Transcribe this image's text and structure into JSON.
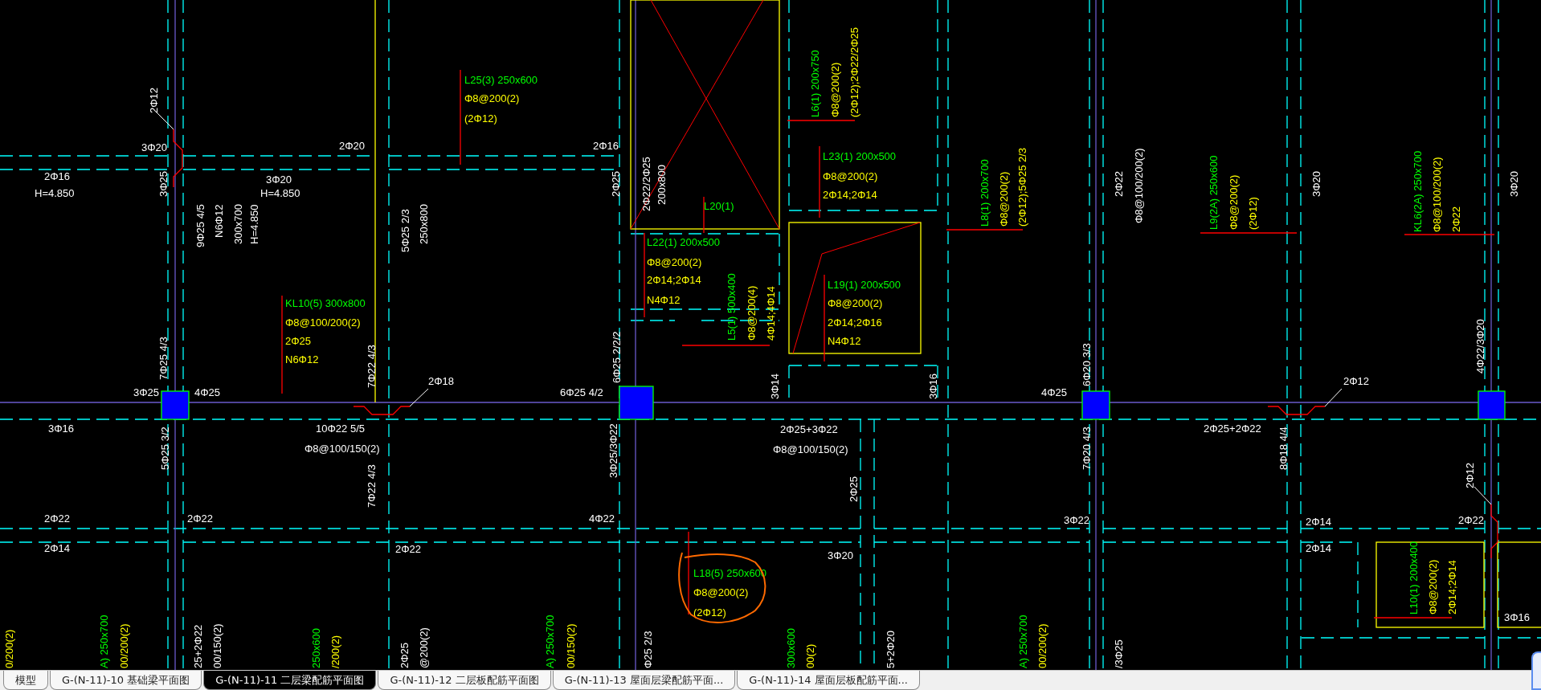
{
  "drawing": {
    "annotations": [
      {
        "text": "2Φ12",
        "color": "#ffffff"
      },
      {
        "text": "3Φ20",
        "color": "#ffffff"
      },
      {
        "text": "2Φ20",
        "color": "#ffffff"
      },
      {
        "text": "L25(3) 250x600",
        "color": "#00ff00"
      },
      {
        "text": "Φ8@200(2)",
        "color": "#ffff00"
      },
      {
        "text": "(2Φ12)",
        "color": "#ffff00"
      },
      {
        "text": "2Φ16",
        "color": "#ffffff"
      },
      {
        "text": "L6(1) 200x750",
        "color": "#00ff00"
      },
      {
        "text": "Φ8@200(2)",
        "color": "#ffff00"
      },
      {
        "text": "(2Φ12);2Φ22/2Φ25",
        "color": "#ffff00"
      },
      {
        "text": "2Φ16",
        "color": "#ffffff"
      },
      {
        "text": "H=4.850",
        "color": "#ffffff"
      },
      {
        "text": "3Φ25",
        "color": "#ffffff"
      },
      {
        "text": "3Φ20",
        "color": "#ffffff"
      },
      {
        "text": "H=4.850",
        "color": "#ffffff"
      },
      {
        "text": "2Φ25",
        "color": "#ffffff"
      },
      {
        "text": "2Φ22/2Φ25",
        "color": "#ffffff"
      },
      {
        "text": "200x800",
        "color": "#ffffff"
      },
      {
        "text": "L20(1)",
        "color": "#00ff00"
      },
      {
        "text": "L23(1) 200x500",
        "color": "#00ff00"
      },
      {
        "text": "Φ8@200(2)",
        "color": "#ffff00"
      },
      {
        "text": "2Φ14;2Φ14",
        "color": "#ffff00"
      },
      {
        "text": "2Φ22",
        "color": "#ffffff"
      },
      {
        "text": "Φ8@100/200(2)",
        "color": "#ffffff"
      },
      {
        "text": "L9(2A) 250x600",
        "color": "#00ff00"
      },
      {
        "text": "Φ8@200(2)",
        "color": "#ffff00"
      },
      {
        "text": "(2Φ12)",
        "color": "#ffff00"
      },
      {
        "text": "3Φ20",
        "color": "#ffffff"
      },
      {
        "text": "KL6(2A) 250x700",
        "color": "#00ff00"
      },
      {
        "text": "Φ8@100/200(2)",
        "color": "#ffff00"
      },
      {
        "text": "2Φ22",
        "color": "#ffff00"
      },
      {
        "text": "3Φ20",
        "color": "#ffffff"
      },
      {
        "text": "9Φ25 4/5",
        "color": "#ffffff"
      },
      {
        "text": "N6Φ12",
        "color": "#ffffff"
      },
      {
        "text": "300x700",
        "color": "#ffffff"
      },
      {
        "text": "H=4.850",
        "color": "#ffffff"
      },
      {
        "text": "5Φ25 2/3",
        "color": "#ffffff"
      },
      {
        "text": "250x800",
        "color": "#ffffff"
      },
      {
        "text": "L8(1) 200x700",
        "color": "#00ff00"
      },
      {
        "text": "Φ8@200(2)",
        "color": "#ffff00"
      },
      {
        "text": "(2Φ12);5Φ25 2/3",
        "color": "#ffff00"
      },
      {
        "text": "L22(1) 200x500",
        "color": "#00ff00"
      },
      {
        "text": "Φ8@200(2)",
        "color": "#ffff00"
      },
      {
        "text": "2Φ14;2Φ14",
        "color": "#ffff00"
      },
      {
        "text": "N4Φ12",
        "color": "#ffff00"
      },
      {
        "text": "L5(1) 500x400",
        "color": "#00ff00"
      },
      {
        "text": "Φ8@200(4)",
        "color": "#ffff00"
      },
      {
        "text": "4Φ14;4Φ14",
        "color": "#ffff00"
      },
      {
        "text": "L19(1) 200x500",
        "color": "#00ff00"
      },
      {
        "text": "Φ8@200(2)",
        "color": "#ffff00"
      },
      {
        "text": "2Φ14;2Φ16",
        "color": "#ffff00"
      },
      {
        "text": "N4Φ12",
        "color": "#ffff00"
      },
      {
        "text": "KL10(5) 300x800",
        "color": "#00ff00"
      },
      {
        "text": "Φ8@100/200(2)",
        "color": "#ffff00"
      },
      {
        "text": "2Φ25",
        "color": "#ffff00"
      },
      {
        "text": "N6Φ12",
        "color": "#ffff00"
      },
      {
        "text": "4Φ22/3Φ20",
        "color": "#ffffff"
      },
      {
        "text": "7Φ25 4/3",
        "color": "#ffffff"
      },
      {
        "text": "7Φ22 4/3",
        "color": "#ffffff"
      },
      {
        "text": "2Φ18",
        "color": "#ffffff"
      },
      {
        "text": "6Φ25 2/2/2",
        "color": "#ffffff"
      },
      {
        "text": "3Φ14",
        "color": "#ffffff"
      },
      {
        "text": "3Φ16",
        "color": "#ffffff"
      },
      {
        "text": "6Φ20 3/3",
        "color": "#ffffff"
      },
      {
        "text": "2Φ12",
        "color": "#ffffff"
      },
      {
        "text": "3Φ25",
        "color": "#ffffff"
      },
      {
        "text": "4Φ25",
        "color": "#ffffff"
      },
      {
        "text": "6Φ25 4/2",
        "color": "#ffffff"
      },
      {
        "text": "4Φ25",
        "color": "#ffffff"
      },
      {
        "text": "3Φ16",
        "color": "#ffffff"
      },
      {
        "text": "10Φ22 5/5",
        "color": "#ffffff"
      },
      {
        "text": "Φ8@100/150(2)",
        "color": "#ffffff"
      },
      {
        "text": "2Φ25+3Φ22",
        "color": "#ffffff"
      },
      {
        "text": "Φ8@100/150(2)",
        "color": "#ffffff"
      },
      {
        "text": "2Φ25+2Φ22",
        "color": "#ffffff"
      },
      {
        "text": "5Φ25 3/2",
        "color": "#ffffff"
      },
      {
        "text": "3Φ25/3Φ22",
        "color": "#ffffff"
      },
      {
        "text": "7Φ20 4/3",
        "color": "#ffffff"
      },
      {
        "text": "8Φ18 4/4",
        "color": "#ffffff"
      },
      {
        "text": "2Φ25",
        "color": "#ffffff"
      },
      {
        "text": "7Φ22 4/3",
        "color": "#ffffff"
      },
      {
        "text": "2Φ12",
        "color": "#ffffff"
      },
      {
        "text": "2Φ22",
        "color": "#ffffff"
      },
      {
        "text": "2Φ22",
        "color": "#ffffff"
      },
      {
        "text": "4Φ22",
        "color": "#ffffff"
      },
      {
        "text": "3Φ22",
        "color": "#ffffff"
      },
      {
        "text": "2Φ14",
        "color": "#ffffff"
      },
      {
        "text": "2Φ22",
        "color": "#ffffff"
      },
      {
        "text": "2Φ14",
        "color": "#ffffff"
      },
      {
        "text": "2Φ22",
        "color": "#ffffff"
      },
      {
        "text": "2Φ14",
        "color": "#ffffff"
      },
      {
        "text": "3Φ20",
        "color": "#ffffff"
      },
      {
        "text": "L18(5) 250x600",
        "color": "#00ff00"
      },
      {
        "text": "Φ8@200(2)",
        "color": "#ffff00"
      },
      {
        "text": "(2Φ12)",
        "color": "#ffff00"
      },
      {
        "text": "L10(1) 200x400",
        "color": "#00ff00"
      },
      {
        "text": "Φ8@200(2)",
        "color": "#ffff00"
      },
      {
        "text": "2Φ14;2Φ14",
        "color": "#ffff00"
      },
      {
        "text": "3Φ16",
        "color": "#ffffff"
      },
      {
        "text": "0/200(2)",
        "color": "#ffff00"
      },
      {
        "text": "A) 250x700",
        "color": "#00ff00"
      },
      {
        "text": "00/200(2)",
        "color": "#ffff00"
      },
      {
        "text": "25+2Φ22",
        "color": "#ffffff"
      },
      {
        "text": "00/150(2)",
        "color": "#ffffff"
      },
      {
        "text": "250x600",
        "color": "#00ff00"
      },
      {
        "text": "/200(2)",
        "color": "#ffff00"
      },
      {
        "text": "2Φ25",
        "color": "#ffffff"
      },
      {
        "text": "@200(2)",
        "color": "#ffffff"
      },
      {
        "text": "A) 250x700",
        "color": "#00ff00"
      },
      {
        "text": "00/150(2)",
        "color": "#ffff00"
      },
      {
        "text": "Φ25 2/3",
        "color": "#ffffff"
      },
      {
        "text": "300x600",
        "color": "#00ff00"
      },
      {
        "text": "00(2)",
        "color": "#ffff00"
      },
      {
        "text": "5+2Φ20",
        "color": "#ffffff"
      },
      {
        "text": "A) 250x700",
        "color": "#00ff00"
      },
      {
        "text": "00/200(2)",
        "color": "#ffff00"
      },
      {
        "text": "/3Φ25",
        "color": "#ffffff"
      }
    ]
  },
  "layout_tabs": [
    {
      "label": "模型",
      "selected": false
    },
    {
      "label": "G-(N-11)-10 基础梁平面图",
      "selected": false
    },
    {
      "label": "G-(N-11)-11 二层梁配筋平面图",
      "selected": true
    },
    {
      "label": "G-(N-11)-12 二层板配筋平面图",
      "selected": false
    },
    {
      "label": "G-(N-11)-13 屋面层梁配筋平面...",
      "selected": false
    },
    {
      "label": "G-(N-11)-14 屋面层板配筋平面...",
      "selected": false
    }
  ]
}
